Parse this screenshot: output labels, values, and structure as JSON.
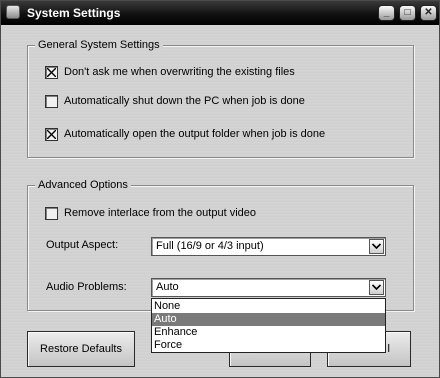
{
  "window": {
    "title": "System Settings",
    "controls": {
      "minimize": "_",
      "maximize": "□",
      "close": "✕"
    }
  },
  "general": {
    "legend": "General System Settings",
    "items": [
      {
        "label": "Don't ask me when overwriting the existing files",
        "checked": true
      },
      {
        "label": "Automatically shut down the PC when job is done",
        "checked": false
      },
      {
        "label": "Automatically open the output folder when job is done",
        "checked": true
      }
    ]
  },
  "advanced": {
    "legend": "Advanced Options",
    "interlace": {
      "label": "Remove interlace from the output video",
      "checked": false
    },
    "output_aspect": {
      "label": "Output Aspect:",
      "value": "Full (16/9 or 4/3 input)"
    },
    "audio_problems": {
      "label": "Audio Problems:",
      "value": "Auto",
      "options": [
        "None",
        "Auto",
        "Enhance",
        "Force"
      ],
      "highlighted_index": 1
    }
  },
  "buttons": {
    "restore": "Restore Defaults",
    "ok_partial": "",
    "cancel_partial": "l"
  },
  "icons": {
    "checkmark": "x-check-icon",
    "dropdown": "chevron-down-icon"
  }
}
